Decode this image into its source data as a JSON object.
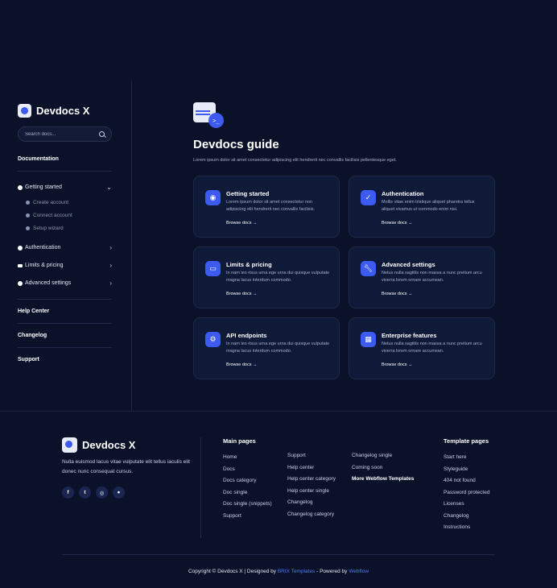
{
  "brand": {
    "name": "Devdocs X"
  },
  "sidebar": {
    "search_placeholder": "Search docs...",
    "documentation": "Documentation",
    "getting_started": "Getting started",
    "sub_items": [
      "Create account",
      "Connect account",
      "Setup wizard"
    ],
    "items": [
      "Authentication",
      "Limits & pricing",
      "Advanced settings"
    ],
    "links": [
      "Help Center",
      "Changelog",
      "Support"
    ]
  },
  "main": {
    "title": "Devdocs guide",
    "subtitle": "Lorem ipsum dolor sit amet consectetur adipiscing elit hendrerit nec convallis facilisis pellentesque eget.",
    "cards": [
      {
        "title": "Getting started",
        "text": "Lorem ipsum dolor sit amet consectetur non adipiscing elit hendrerit nec convallis facilisis.",
        "link": "Browse docs",
        "icon": "compass-icon"
      },
      {
        "title": "Authentication",
        "text": "Mollis vitae enim tristique aliquet pharetra tellus aliquet vivamus ut commodo enim nisi.",
        "link": "Browse docs",
        "icon": "check-badge-icon"
      },
      {
        "title": "Limits & pricing",
        "text": "In nam leo risus urna ege urna dui quisque vulputate magna lacus interdum commodo.",
        "link": "Browse docs",
        "icon": "credit-card-icon"
      },
      {
        "title": "Advanced settings",
        "text": "Netus nulla sagittis non massa a nunc pretium arcu viverra lorem ornare accumsan.",
        "link": "Browse docs",
        "icon": "wrench-icon"
      },
      {
        "title": "API endpoints",
        "text": "In nam leo risus urna ege urna dui quisque vulputate magna lacus interdum commodo.",
        "link": "Browse docs",
        "icon": "gear-icon"
      },
      {
        "title": "Enterprise features",
        "text": "Netus nulla sagittis non massa a nunc pretium arcu viverra lorem ornare accumsan.",
        "link": "Browse docs",
        "icon": "grid-icon"
      }
    ]
  },
  "footer": {
    "description": "Nulla euismod lacus vitae vulputate elit tellus iaculis elit donec nunc consequat cursus.",
    "socials": [
      "f",
      "t",
      "ig",
      "gh"
    ],
    "main_pages_heading": "Main pages",
    "col1": [
      "Home",
      "Docs",
      "Docs category",
      "Doc single",
      "Doc single (snippets)",
      "Support"
    ],
    "col2": [
      "Support",
      "Help center",
      "Help center category",
      "Help center single",
      "Changelog",
      "Changelog category"
    ],
    "col3": [
      "Changelog single",
      "Coming soon",
      "More Webflow Templates"
    ],
    "template_pages_heading": "Template pages",
    "col4": [
      "Start here",
      "Styleguide",
      "404 not found",
      "Password protected",
      "Licenses",
      "Changelog",
      "Instructions"
    ],
    "copyright_a": "Copyright © Devdocs X | Designed by ",
    "copyright_b": "BRIX Templates",
    "copyright_c": " - Powered by ",
    "copyright_d": "Webflow"
  },
  "colors": {
    "background": "#0a1128",
    "accent": "#3d5af1",
    "link": "#4f7df3"
  }
}
